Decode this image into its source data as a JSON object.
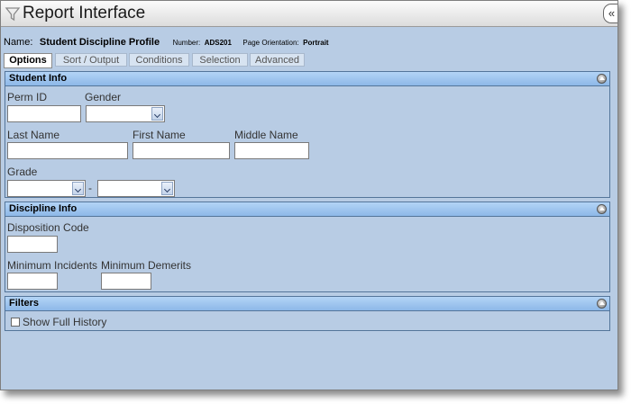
{
  "window": {
    "title": "Report Interface",
    "collapse_glyph": "«"
  },
  "report": {
    "name_label": "Name:",
    "name_value": "Student Discipline Profile",
    "number_label": "Number:",
    "number_value": "ADS201",
    "orientation_label": "Page Orientation:",
    "orientation_value": "Portrait"
  },
  "tabs": [
    {
      "label": "Options",
      "active": true
    },
    {
      "label": "Sort / Output",
      "active": false
    },
    {
      "label": "Conditions",
      "active": false
    },
    {
      "label": "Selection",
      "active": false
    },
    {
      "label": "Advanced",
      "active": false
    }
  ],
  "student_info": {
    "title": "Student Info",
    "perm_id_label": "Perm ID",
    "perm_id_value": "",
    "gender_label": "Gender",
    "gender_value": "",
    "last_name_label": "Last Name",
    "last_name_value": "",
    "first_name_label": "First Name",
    "first_name_value": "",
    "middle_name_label": "Middle Name",
    "middle_name_value": "",
    "grade_label": "Grade",
    "grade_from_value": "",
    "grade_to_value": "",
    "range_separator": "-"
  },
  "discipline_info": {
    "title": "Discipline Info",
    "disposition_code_label": "Disposition Code",
    "disposition_code_value": "",
    "min_incidents_label": "Minimum Incidents",
    "min_incidents_value": "",
    "min_demerits_label": "Minimum Demerits",
    "min_demerits_value": ""
  },
  "filters": {
    "title": "Filters",
    "show_full_history_label": "Show Full History",
    "show_full_history_checked": false
  },
  "icons": {
    "title_icon": "funnel-icon",
    "section_collapse_icon": "collapse-up-icon"
  }
}
